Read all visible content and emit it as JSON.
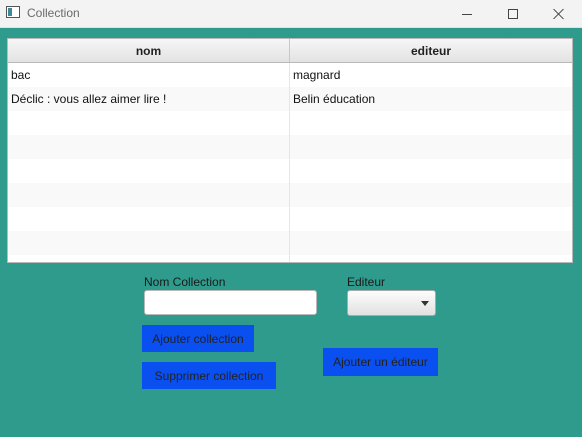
{
  "window": {
    "title": "Collection"
  },
  "table": {
    "columns": [
      "nom",
      "editeur"
    ],
    "rows": [
      [
        "bac",
        "magnard"
      ],
      [
        "Déclic : vous allez aimer lire !",
        "Belin éducation"
      ]
    ]
  },
  "form": {
    "nom_label": "Nom Collection",
    "nom_value": "",
    "editeur_label": "Editeur",
    "editeur_value": ""
  },
  "buttons": {
    "add": "Ajouter collection",
    "delete": "Supprimer collection",
    "add_editor": "Ajouter un éditeur"
  },
  "colors": {
    "background": "#2e9b8c",
    "button": "#0a4ff0"
  }
}
